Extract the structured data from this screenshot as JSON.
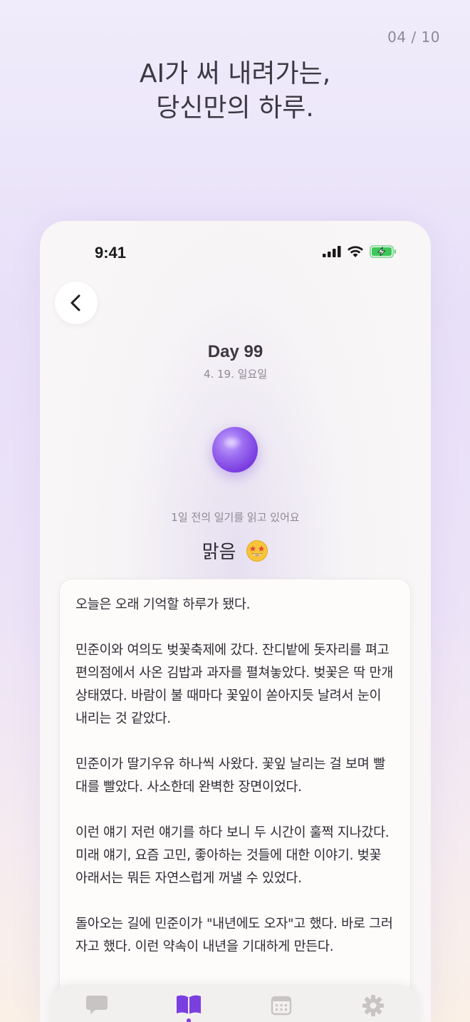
{
  "page_counter": "04 / 10",
  "headline": {
    "line1": "AI가 써 내려가는,",
    "line2": "당신만의 하루."
  },
  "status_bar": {
    "time": "9:41",
    "icons": [
      "signal-icon",
      "wifi-icon",
      "battery-charging-icon"
    ]
  },
  "diary": {
    "day_title": "Day 99",
    "date": "4. 19. 일요일",
    "reading_status": "1일 전의 일기를 읽고 있어요",
    "weather": "맑음",
    "mood_icon": "star-struck-emoji-icon",
    "paragraphs": [
      "오늘은 오래 기억할 하루가 됐다.",
      "민준이와 여의도 벚꽃축제에 갔다. 잔디밭에 돗자리를 펴고 편의점에서 사온 김밥과 과자를 펼쳐놓았다. 벚꽃은 딱 만개 상태였다. 바람이 불 때마다 꽃잎이 쏟아지듯 날려서 눈이 내리는 것 같았다.",
      "민준이가 딸기우유 하나씩 사왔다. 꽃잎 날리는 걸 보며 빨대를 빨았다. 사소한데 완벽한 장면이었다.",
      "이런 얘기 저런 얘기를 하다 보니 두 시간이 훌쩍 지나갔다. 미래 얘기, 요즘 고민, 좋아하는 것들에 대한 이야기. 벚꽃 아래서는 뭐든 자연스럽게 꺼낼 수 있었다.",
      "돌아오는 길에 민준이가 \"내년에도 오자\"고 했다. 바로 그러자고 했다. 이런 약속이 내년을 기대하게 만든다."
    ]
  },
  "tab_bar": {
    "tabs": [
      {
        "icon": "chat-bubble-icon",
        "active": false
      },
      {
        "icon": "open-book-icon",
        "active": true
      },
      {
        "icon": "calendar-icon",
        "active": false
      },
      {
        "icon": "gear-icon",
        "active": false
      }
    ]
  },
  "colors": {
    "accent": "#7b3fe0",
    "tab_inactive": "#c9c4c4",
    "battery_green": "#3cc85a"
  }
}
